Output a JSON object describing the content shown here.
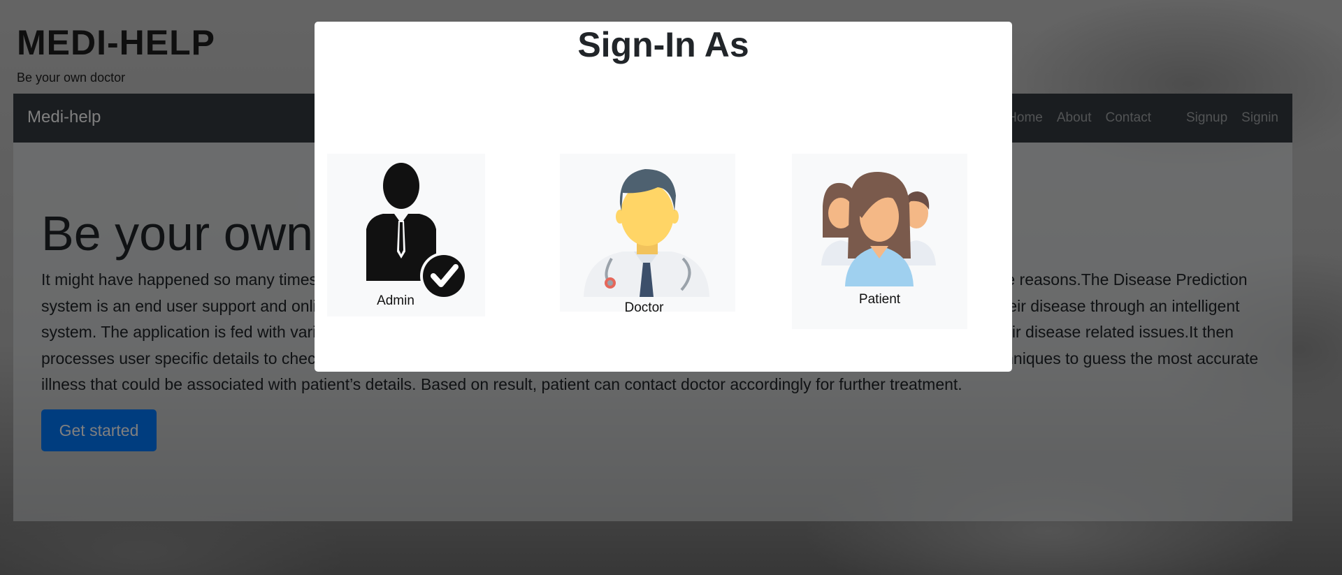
{
  "brand": {
    "title": "MEDI-HELP",
    "tagline": "Be your own doctor"
  },
  "navbar": {
    "brand": "Medi-help",
    "links": [
      "Home",
      "About",
      "Contact",
      "Signup",
      "Signin"
    ]
  },
  "hero": {
    "title": "Be your own doctor",
    "text": "It might have happened so many times that you or someone yours need doctors help immediately, but they are not available due to some reasons.The Disease Prediction system is an end user support and online consultation project. Here we propose a system that allows users to get instant guidance on their disease through an intelligent system. The application is fed with various details and the disease associated with those details. The application allows user to share their disease related issues.It then processes user specific details to check for various illness that could be associated with it. Here we use some intelligent data mining techniques to guess the most accurate illness that could be associated with patient’s details. Based on result, patient can contact doctor accordingly for further treatment.",
    "button": "Get started"
  },
  "modal": {
    "title": "Sign-In As",
    "roles": [
      {
        "label": "Admin",
        "icon": "admin-icon"
      },
      {
        "label": "Doctor",
        "icon": "doctor-icon"
      },
      {
        "label": "Patient",
        "icon": "patient-icon"
      }
    ]
  },
  "colors": {
    "navbar": "#343a40",
    "primary": "#007bff",
    "modal_bg": "#ffffff",
    "card_bg": "#f8f9fa"
  }
}
